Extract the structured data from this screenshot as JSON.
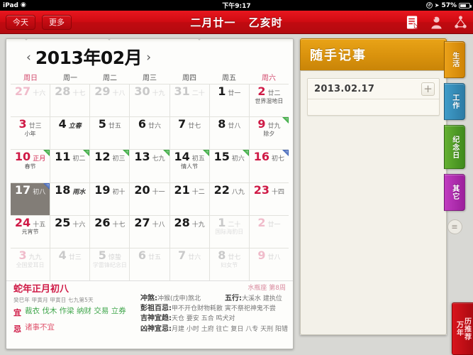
{
  "statusbar": {
    "device": "iPad",
    "wifi_icon": "wifi-icon",
    "time": "下午9:17",
    "lock_icon": "rotation-lock-icon",
    "location_icon": "location-arrow-icon",
    "battery_text": "57%",
    "battery_icon": "battery-icon"
  },
  "toolbar": {
    "today_label": "今天",
    "more_label": "更多",
    "title_lunar": "二月廿一",
    "title_hour": "乙亥时",
    "icons": [
      "note-icon",
      "account-icon",
      "share-icon"
    ]
  },
  "calendar": {
    "prev_icon": "chevron-left-icon",
    "next_icon": "chevron-right-icon",
    "month_title": "2013年02月",
    "weekdays": [
      {
        "label": "周日",
        "red": true
      },
      {
        "label": "周一",
        "red": false
      },
      {
        "label": "周二",
        "red": false
      },
      {
        "label": "周三",
        "red": false
      },
      {
        "label": "周四",
        "red": false
      },
      {
        "label": "周五",
        "red": false
      },
      {
        "label": "周六",
        "red": true
      }
    ],
    "weeks": [
      [
        {
          "day": "27",
          "lunar": "十六",
          "festival": "",
          "out": true,
          "sun": true
        },
        {
          "day": "28",
          "lunar": "十七",
          "festival": "",
          "out": true
        },
        {
          "day": "29",
          "lunar": "十八",
          "festival": "",
          "out": true
        },
        {
          "day": "30",
          "lunar": "十九",
          "festival": "",
          "out": true
        },
        {
          "day": "31",
          "lunar": "二十",
          "festival": "",
          "out": true
        },
        {
          "day": "1",
          "lunar": "廿一",
          "festival": ""
        },
        {
          "day": "2",
          "lunar": "廿二",
          "festival": "世界湿地日",
          "sat": true
        }
      ],
      [
        {
          "day": "3",
          "lunar": "廿三",
          "festival": "小年",
          "sun": true
        },
        {
          "day": "4",
          "lunar": "立春",
          "festival": "",
          "lunitalic": true
        },
        {
          "day": "5",
          "lunar": "廿五",
          "festival": ""
        },
        {
          "day": "6",
          "lunar": "廿六",
          "festival": ""
        },
        {
          "day": "7",
          "lunar": "廿七",
          "festival": ""
        },
        {
          "day": "8",
          "lunar": "廿八",
          "festival": ""
        },
        {
          "day": "9",
          "lunar": "廿九",
          "festival": "除夕",
          "sat": true,
          "corner": "green"
        }
      ],
      [
        {
          "day": "10",
          "lunar": "正月",
          "festival": "春节",
          "sun": true,
          "lunred": true,
          "corner": "green"
        },
        {
          "day": "11",
          "lunar": "初二",
          "festival": "",
          "corner": "green"
        },
        {
          "day": "12",
          "lunar": "初三",
          "festival": "",
          "corner": "green"
        },
        {
          "day": "13",
          "lunar": "七九",
          "festival": "",
          "corner": "green"
        },
        {
          "day": "14",
          "lunar": "初五",
          "festival": "情人节",
          "corner": "green"
        },
        {
          "day": "15",
          "lunar": "初六",
          "festival": "",
          "corner": "green"
        },
        {
          "day": "16",
          "lunar": "初七",
          "festival": "",
          "sat": true,
          "corner": "blue"
        }
      ],
      [
        {
          "day": "17",
          "lunar": "初八",
          "festival": "",
          "sun": true,
          "selected": true,
          "corner": "blue"
        },
        {
          "day": "18",
          "lunar": "雨水",
          "festival": "",
          "lunitalic": true
        },
        {
          "day": "19",
          "lunar": "初十",
          "festival": ""
        },
        {
          "day": "20",
          "lunar": "十一",
          "festival": ""
        },
        {
          "day": "21",
          "lunar": "十二",
          "festival": ""
        },
        {
          "day": "22",
          "lunar": "八九",
          "festival": ""
        },
        {
          "day": "23",
          "lunar": "十四",
          "festival": "",
          "sat": true
        }
      ],
      [
        {
          "day": "24",
          "lunar": "十五",
          "festival": "元宵节",
          "sun": true
        },
        {
          "day": "25",
          "lunar": "十六",
          "festival": ""
        },
        {
          "day": "26",
          "lunar": "十七",
          "festival": ""
        },
        {
          "day": "27",
          "lunar": "十八",
          "festival": ""
        },
        {
          "day": "28",
          "lunar": "十九",
          "festival": ""
        },
        {
          "day": "1",
          "lunar": "二十",
          "festival": "国际海豹日",
          "out": true
        },
        {
          "day": "2",
          "lunar": "廿一",
          "festival": "",
          "out": true,
          "sat": true
        }
      ],
      [
        {
          "day": "3",
          "lunar": "九九",
          "festival": "全国爱耳日",
          "out": true,
          "sun": true
        },
        {
          "day": "4",
          "lunar": "廿三",
          "festival": "",
          "out": true
        },
        {
          "day": "5",
          "lunar": "惊蛰",
          "festival": "学雷锋纪念日",
          "out": true
        },
        {
          "day": "6",
          "lunar": "廿五",
          "festival": "",
          "out": true
        },
        {
          "day": "7",
          "lunar": "廿六",
          "festival": "",
          "out": true
        },
        {
          "day": "8",
          "lunar": "廿七",
          "festival": "妇女节",
          "out": true
        },
        {
          "day": "9",
          "lunar": "廿八",
          "festival": "",
          "out": true,
          "sat": true
        }
      ]
    ]
  },
  "almanac": {
    "title": "蛇年正月初八",
    "subtitle": "癸巳年 甲寅月 甲寅日 七九第5天",
    "yi_label": "宜",
    "yi_text": "裁衣 伐木 作梁 纳财 交易 立券",
    "ji_label": "忌",
    "ji_text": "诸事不宜",
    "zodiac_week": "水瓶座 第8周",
    "rows": [
      {
        "label": "冲煞:",
        "value": "冲猴(戊申)煞北",
        "extra_label": "五行:",
        "extra_value": "大溪水 建执位"
      },
      {
        "label": "彭祖百忌:",
        "value": "甲不开仓财物耗散 寅不祭祀神鬼不尝"
      },
      {
        "label": "吉神宜趋:",
        "value": "天仓 要安 五合 鸣犬对"
      },
      {
        "label": "凶神宜忌:",
        "value": "月建 小时 土府 往亡 复日 八专 天刑 阳错"
      }
    ]
  },
  "notes": {
    "header_title": "随手记事",
    "card_date": "2013.02.17",
    "add_icon": "plus-icon",
    "list_icon": "list-icon",
    "tabs": [
      {
        "label": "生活",
        "color": "#eba21a",
        "key": "life"
      },
      {
        "label": "工作",
        "color": "#3f9cc9",
        "key": "work"
      },
      {
        "label": "纪念日",
        "color": "#64b032",
        "key": "anniv"
      },
      {
        "label": "其它",
        "color": "#c03cc0",
        "key": "other"
      }
    ]
  },
  "ribbon": {
    "line1": "万年",
    "line2": "历推荐"
  }
}
